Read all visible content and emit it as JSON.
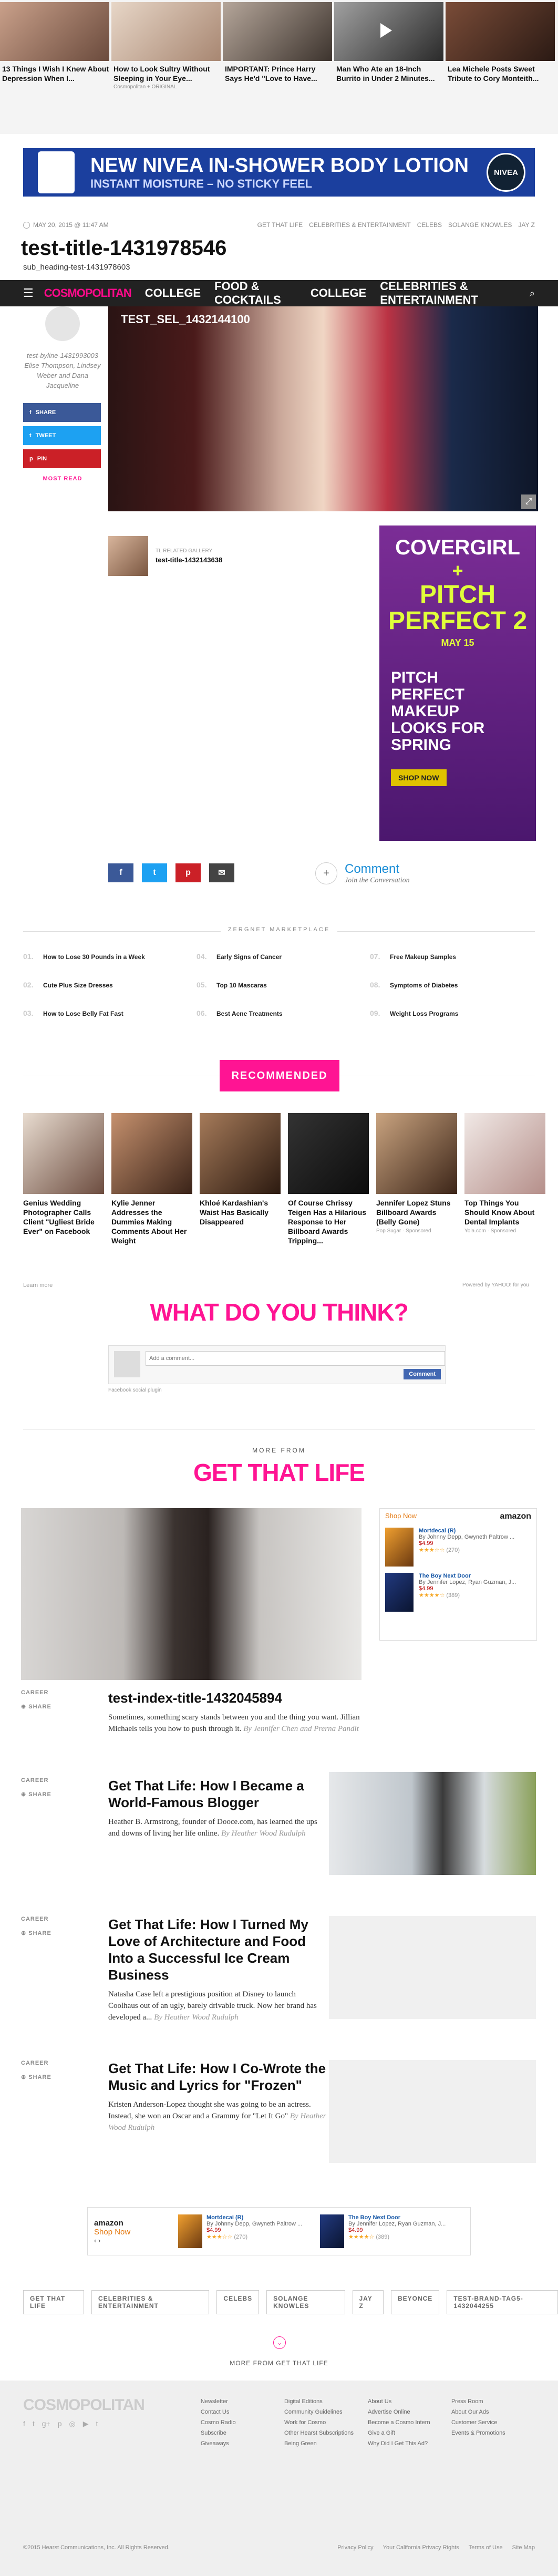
{
  "top_stories": [
    {
      "title": "13 Things I Wish I Knew About Depression When I...",
      "source": ""
    },
    {
      "title": "How to Look Sultry Without Sleeping in Your Eye...",
      "source": "Cosmopolitan + ORIGINAL"
    },
    {
      "title": "IMPORTANT: Prince Harry Says He'd \"Love to Have...",
      "source": ""
    },
    {
      "title": "Man Who Ate an 18-Inch Burrito in Under 2 Minutes...",
      "source": ""
    },
    {
      "title": "Lea Michele Posts Sweet Tribute to Cory Monteith...",
      "source": ""
    }
  ],
  "banner_ad": {
    "line1": "NEW NIVEA IN-SHOWER BODY LOTION",
    "line2": "INSTANT MOISTURE – NO STICKY FEEL",
    "logo": "NIVEA",
    "accent": "#1b3f9e"
  },
  "article_meta": {
    "date": "MAY 20, 2015 @ 11:47 AM",
    "tags": [
      "GET THAT LIFE",
      "CELEBRITIES & ENTERTAINMENT",
      "CELEBS",
      "SOLANGE KNOWLES",
      "JAY Z"
    ]
  },
  "title": "test-title-1431978546",
  "sub_heading": "sub_heading-test-1431978603",
  "nav": {
    "brand": "COSMOPOLITAN",
    "items": [
      "COLLEGE",
      "FOOD & COCKTAILS",
      "COLLEGE",
      "CELEBRITIES & ENTERTAINMENT"
    ],
    "brand_color": "#ff0a8a"
  },
  "hero_overlay_title": "TEST_SEL_1432144100",
  "byline": "test-byline-1431993003 Elise Thompson, Lindsey Weber and Dana Jacqueline",
  "share": {
    "facebook": "SHARE",
    "twitter": "TWEET",
    "pinterest": "PIN",
    "most_read": "MOST READ"
  },
  "related_gallery": {
    "label": "TL RELATED GALLERY",
    "title": "test-title-1432143638"
  },
  "ad_right": {
    "brand": "COVERGIRL",
    "plus": "+",
    "film": "PITCH PERFECT 2",
    "date": "MAY 15",
    "headline": "PITCH PERFECT MAKEUP LOOKS FOR SPRING",
    "cta": "SHOP NOW"
  },
  "comment": {
    "label": "Comment",
    "sub": "Join the Conversation"
  },
  "zergnet": {
    "header": "ZERGNET MARKETPLACE",
    "items": [
      [
        "01.",
        "How to Lose 30 Pounds in a Week"
      ],
      [
        "04.",
        "Early Signs of Cancer"
      ],
      [
        "07.",
        "Free Makeup Samples"
      ],
      [
        "02.",
        "Cute Plus Size Dresses"
      ],
      [
        "05.",
        "Top 10 Mascaras"
      ],
      [
        "08.",
        "Symptoms of Diabetes"
      ],
      [
        "03.",
        "How to Lose Belly Fat Fast"
      ],
      [
        "06.",
        "Best Acne Treatments"
      ],
      [
        "09.",
        "Weight Loss Programs"
      ]
    ]
  },
  "recommended": {
    "label": "RECOMMENDED",
    "cards": [
      {
        "title": "Genius Wedding Photographer Calls Client \"Ugliest Bride Ever\" on Facebook",
        "sponsor": ""
      },
      {
        "title": "Kylie Jenner Addresses the Dummies Making Comments About Her Weight",
        "sponsor": ""
      },
      {
        "title": "Khloé Kardashian's Waist Has Basically Disappeared",
        "sponsor": ""
      },
      {
        "title": "Of Course Chrissy Teigen Has a Hilarious Response to Her Billboard Awards Tripping...",
        "sponsor": ""
      },
      {
        "title": "Jennifer Lopez Stuns Billboard Awards (Belly Gone)",
        "sponsor": "Pop Sugar · Sponsored"
      },
      {
        "title": "Top Things You Should Know About Dental Implants",
        "sponsor": "Yola.com · Sponsored"
      }
    ],
    "learn_more": "Learn more",
    "powered": "Powered by YAHOO! for you"
  },
  "wdyt": {
    "heading": "WHAT DO YOU THINK?",
    "placeholder": "Add a comment...",
    "button": "Comment",
    "plugin": "Facebook social plugin"
  },
  "more_from": "MORE FROM",
  "get_that_life": "GET THAT LIFE",
  "amazon_widget": {
    "shop_now": "Shop Now",
    "logo": "amazon",
    "items": [
      {
        "title": "Mortdecai (R)",
        "author": "By Johnny Depp, Gwyneth Paltrow ...",
        "price": "$4.99",
        "count": "(270)"
      },
      {
        "title": "The Boy Next Door",
        "author": "By Jennifer Lopez, Ryan Guzman, J...",
        "price": "$4.99",
        "count": "(389)"
      }
    ]
  },
  "articles": [
    {
      "tag": "CAREER",
      "share": "SHARE",
      "title": "test-index-title-1432045894",
      "dek": "Sometimes, something scary stands between you and the thing you want. Jillian Michaels tells you how to push through it.",
      "by": "By Jennifer Chen and Prerna Pandit"
    },
    {
      "tag": "CAREER",
      "share": "SHARE",
      "title": "Get That Life: How I Became a World-Famous Blogger",
      "dek": "Heather B. Armstrong, founder of Dooce.com, has learned the ups and downs of living her life online.",
      "by": "By Heather Wood Rudulph"
    },
    {
      "tag": "CAREER",
      "share": "SHARE",
      "title": "Get That Life: How I Turned My Love of Architecture and Food Into a Successful Ice Cream Business",
      "dek": "Natasha Case left a prestigious position at Disney to launch Coolhaus out of an ugly, barely drivable truck. Now her brand has developed a...",
      "by": "By Heather Wood Rudulph"
    },
    {
      "tag": "CAREER",
      "share": "SHARE",
      "title": "Get That Life: How I Co-Wrote the Music and Lyrics for \"Frozen\"",
      "dek": "Kristen Anderson-Lopez thought she was going to be an actress. Instead, she won an Oscar and a Grammy for \"Let It Go\"",
      "by": "By Heather Wood Rudulph"
    }
  ],
  "bottom_tags": [
    "GET THAT LIFE",
    "CELEBRITIES & ENTERTAINMENT",
    "CELEBS",
    "SOLANGE KNOWLES",
    "JAY Z",
    "BEYONCE",
    "TEST-BRAND-TAG5-1432044255"
  ],
  "more_from_footer": "MORE FROM GET THAT LIFE",
  "footer": {
    "logo": "COSMOPOLITAN",
    "col1": [
      "Newsletter",
      "Contact Us",
      "Cosmo Radio",
      "Subscribe",
      "Giveaways"
    ],
    "col2": [
      "Digital Editions",
      "Community Guidelines",
      "Work for Cosmo",
      "Other Hearst Subscriptions",
      "Being Green"
    ],
    "col3": [
      "About Us",
      "Advertise Online",
      "Become a Cosmo Intern",
      "Give a Gift",
      "Why Did I Get This Ad?"
    ],
    "col4": [
      "Press Room",
      "About Our Ads",
      "Customer Service",
      "Events & Promotions"
    ],
    "copyright": "©2015 Hearst Communications, Inc. All Rights Reserved.",
    "links": [
      "Privacy Policy",
      "Your California Privacy Rights",
      "Terms of Use",
      "Site Map"
    ]
  }
}
